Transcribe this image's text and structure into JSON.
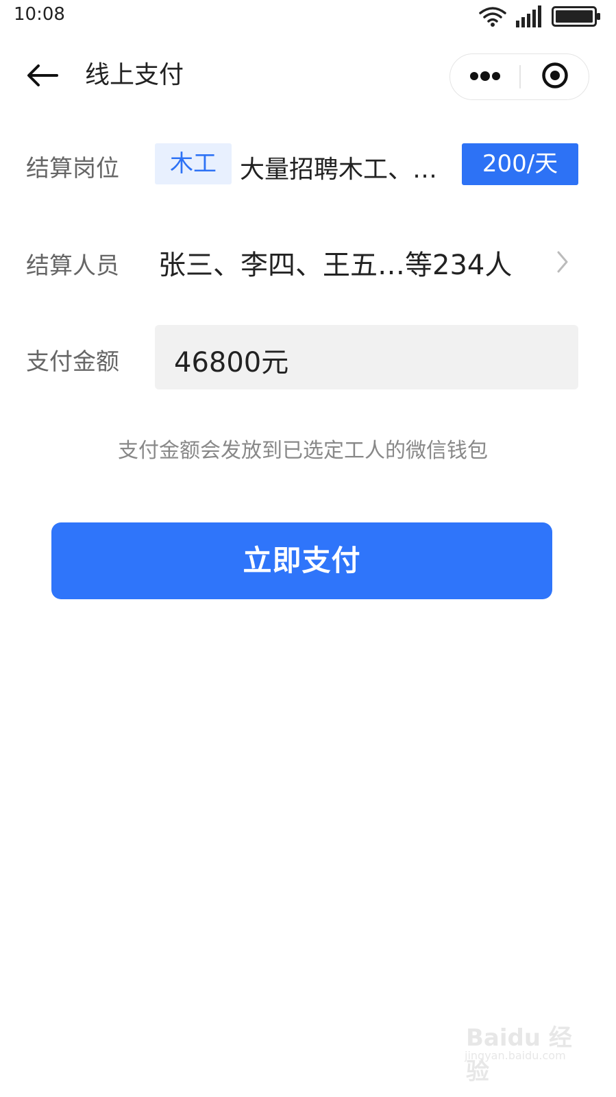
{
  "status_bar": {
    "time": "10:08",
    "icons": [
      "wifi-icon",
      "signal-icon",
      "battery-icon"
    ]
  },
  "nav": {
    "back_icon": "arrow-left-icon",
    "title": "线上支付",
    "more_icon": "more-dots-icon",
    "close_icon": "target-close-icon"
  },
  "form": {
    "post": {
      "label": "结算岗位",
      "tag": "木工",
      "job_title": "大量招聘木工、…",
      "wage": "200/天"
    },
    "people": {
      "label": "结算人员",
      "value": "张三、李四、王五…等234人",
      "chevron_icon": "chevron-right-icon"
    },
    "amount": {
      "label": "支付金额",
      "value": "46800元"
    },
    "hint": "支付金额会发放到已选定工人的微信钱包"
  },
  "pay_button": {
    "label": "立即支付"
  },
  "watermark": {
    "brand": "Baidu 经验",
    "url": "jingyan.baidu.com"
  },
  "colors": {
    "primary": "#2f75fa",
    "tag_bg": "#e8f0fe",
    "label_gray": "#666666",
    "hint_gray": "#888888",
    "input_bg": "#f1f1f1"
  }
}
